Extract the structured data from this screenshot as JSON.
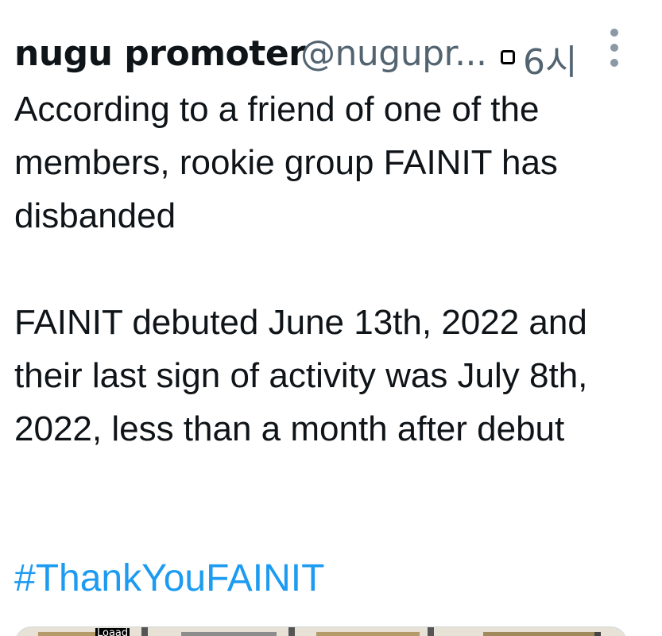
{
  "tweet": {
    "display_name": "nugu promoter",
    "handle": "@nugupr...",
    "timestamp": "6시",
    "body_paragraphs": [
      "According to a friend of one of the members, rookie group FAINIT has disbanded",
      "FAINIT debuted June 13th, 2022 and their last sign of activity was July 8th, 2022, less than a month after debut"
    ],
    "hashtag": "#ThankYouFAINIT"
  },
  "media": {
    "loading_label": "Loaad"
  },
  "icons": {
    "more": "more-vertical-icon",
    "verified": "badge-icon"
  },
  "colors": {
    "text": "#0f1419",
    "muted": "#536471",
    "link": "#1d9bf0"
  }
}
